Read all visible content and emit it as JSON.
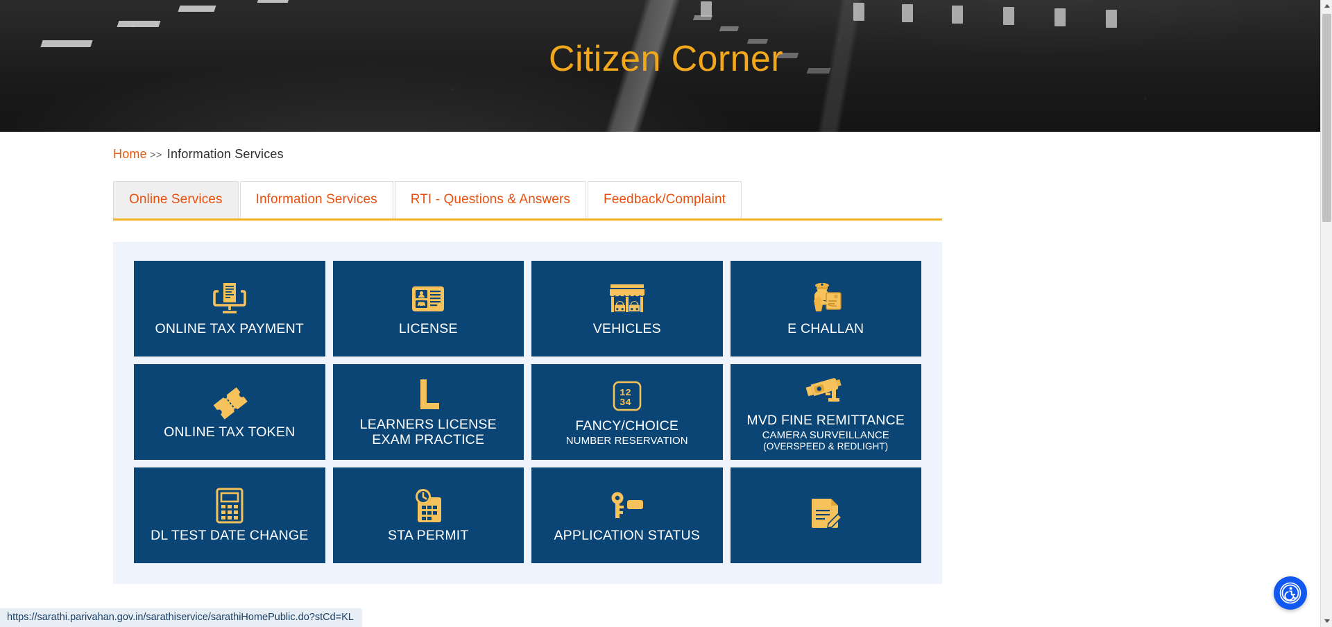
{
  "hero": {
    "title": "Citizen Corner"
  },
  "breadcrumb": {
    "home_label": "Home",
    "separator": ">>",
    "current_label": "Information Services"
  },
  "tabs": [
    {
      "label": "Online Services",
      "active": true
    },
    {
      "label": "Information Services",
      "active": false
    },
    {
      "label": "RTI - Questions & Answers",
      "active": false
    },
    {
      "label": "Feedback/Complaint",
      "active": false
    }
  ],
  "tiles": [
    {
      "label": "ONLINE TAX PAYMENT",
      "sub": "",
      "sub2": "",
      "icon": "monitor-invoice-icon"
    },
    {
      "label": "LICENSE",
      "sub": "",
      "sub2": "",
      "icon": "id-card-icon"
    },
    {
      "label": "VEHICLES",
      "sub": "",
      "sub2": "",
      "icon": "showroom-cars-icon"
    },
    {
      "label": "E CHALLAN",
      "sub": "",
      "sub2": "",
      "icon": "police-ticket-icon"
    },
    {
      "label": "ONLINE TAX TOKEN",
      "sub": "",
      "sub2": "",
      "icon": "ticket-icon"
    },
    {
      "label": "LEARNERS LICENSE",
      "sub": "EXAM PRACTICE",
      "sub2": "",
      "icon": "letter-l-icon"
    },
    {
      "label": "FANCY/CHOICE",
      "sub": "NUMBER RESERVATION",
      "sub2": "",
      "icon": "number-plate-1234-icon"
    },
    {
      "label": "MVD FINE REMITTANCE",
      "sub": "CAMERA SURVEILLANCE",
      "sub2": "(OVERSPEED & REDLIGHT)",
      "icon": "cctv-camera-icon"
    },
    {
      "label": "DL TEST DATE CHANGE",
      "sub": "",
      "sub2": "",
      "icon": "calculator-icon"
    },
    {
      "label": "STA PERMIT",
      "sub": "",
      "sub2": "",
      "icon": "clock-calendar-icon"
    },
    {
      "label": "APPLICATION STATUS",
      "sub": "",
      "sub2": "",
      "icon": "key-icon"
    },
    {
      "label": "",
      "sub": "",
      "sub2": "",
      "icon": "document-pen-icon"
    }
  ],
  "status_bar": {
    "url": "https://sarathi.parivahan.gov.in/sarathiservice/sarathiHomePublic.do?stCd=KL"
  },
  "accessibility": {
    "label": "Accessibility"
  },
  "colors": {
    "tile_bg": "#0a4576",
    "tile_icon": "#f6c25b",
    "panel_bg": "#eef3fc",
    "accent_orange": "#e8500f",
    "accent_gold": "#f2a81d",
    "rule_gold": "#f5b324",
    "a11y_blue": "#1058ef"
  }
}
